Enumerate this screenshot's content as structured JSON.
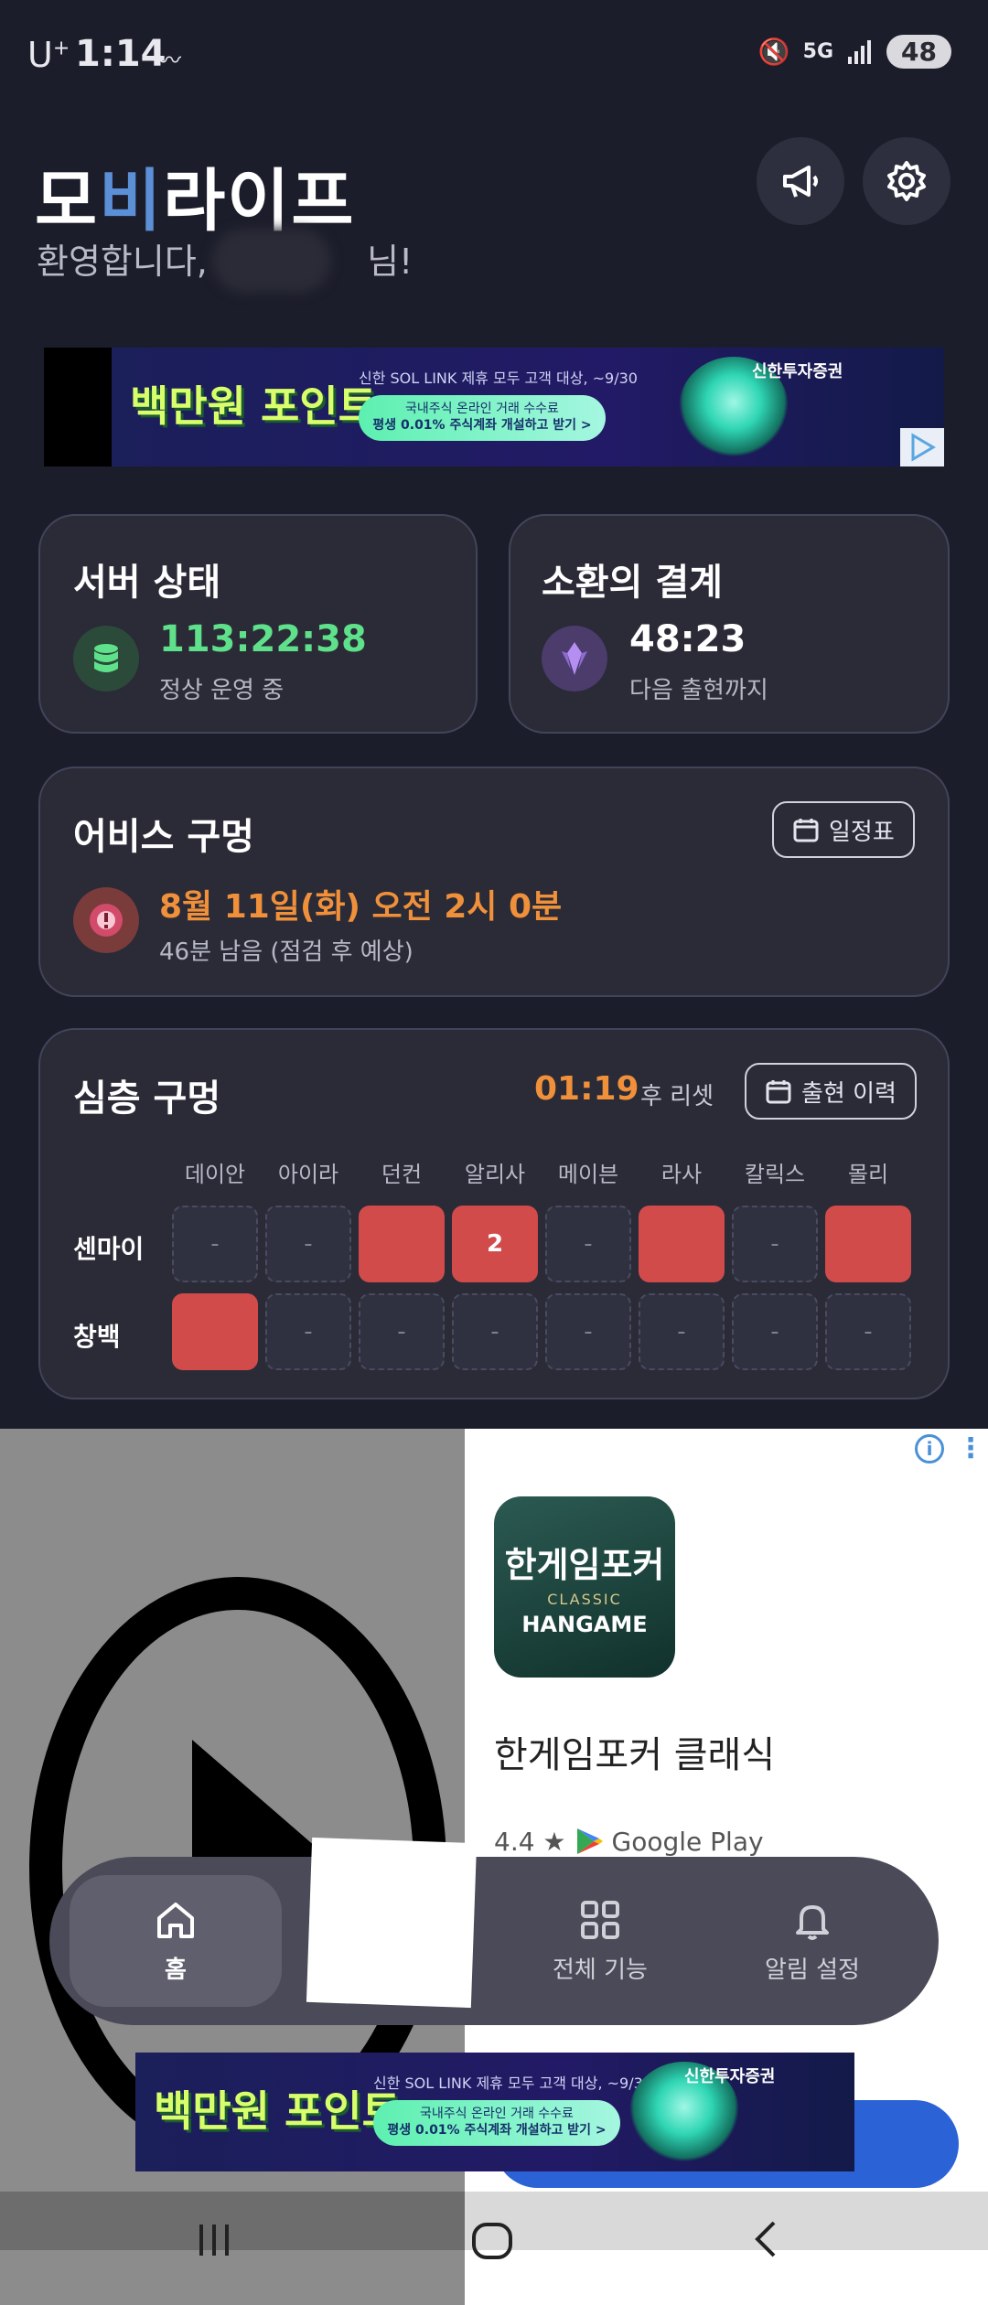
{
  "status_bar": {
    "carrier": "U",
    "carrier_sup": "+",
    "time": "1:14",
    "network": "5G",
    "battery": "48"
  },
  "header": {
    "title_part1": "모",
    "title_accent": "비",
    "title_part2": "라이프",
    "welcome_prefix": "환영합니다,",
    "welcome_suffix": "님!"
  },
  "banner_ad": {
    "points_text": "백만원 포인트",
    "line1": "신한 SOL LINK 제휴 모두 고객 대상, ~9/30",
    "pill_line1": "국내주식 온라인 거래 수수료",
    "pill_line2": "평생 0.01% 주식계좌 개설하고 받기 >",
    "brand": "신한투자증권"
  },
  "server_card": {
    "title": "서버 상태",
    "value": "113:22:38",
    "status": "정상 운영 중"
  },
  "summon_card": {
    "title": "소환의 결계",
    "value": "48:23",
    "sub": "다음 출현까지"
  },
  "abyss_card": {
    "title": "어비스 구멍",
    "schedule_button": "일정표",
    "date": "8월 11일(화) 오전 2시 0분",
    "sub": "46분 남음 (점검 후 예상)"
  },
  "deep_card": {
    "title": "심층 구멍",
    "timer": "01:19",
    "reset_label": "후 리셋",
    "history_button": "출현 이력",
    "columns": [
      "데이안",
      "아이라",
      "던컨",
      "알리사",
      "메이븐",
      "라사",
      "칼릭스",
      "몰리"
    ],
    "rows": [
      {
        "label": "센마이",
        "cells": [
          "-",
          "-",
          "",
          "2",
          "-",
          "",
          "-",
          ""
        ]
      },
      {
        "label": "창백",
        "cells": [
          "",
          "-",
          "-",
          "-",
          "-",
          "-",
          "-",
          "-"
        ]
      }
    ]
  },
  "app_ad": {
    "icon_title": "한게임포커",
    "icon_classic": "CLASSIC",
    "icon_brand": "HANGAME",
    "name": "한게임포커 클래식",
    "rating": "4.4 ★",
    "store": "Google Play",
    "info_icon": "i"
  },
  "bottom_nav": {
    "home": "홈",
    "all_features": "전체 기능",
    "alert_settings": "알림 설정"
  }
}
